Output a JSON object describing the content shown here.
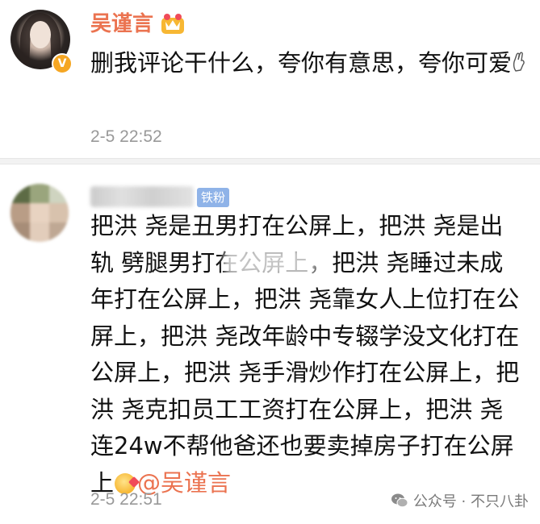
{
  "comment1": {
    "username": "吴谨言",
    "text": "删我评论干什么，夸你有意思，夸你可爱",
    "timestamp": "2-5 22:52",
    "verified_badge": "V",
    "vip_icon": "crown-icon"
  },
  "comment2": {
    "username_blurred": "",
    "fan_badge": "铁粉",
    "text_before": "把洪 尧是丑男打在公屏上，把洪 尧是出轨 劈腿男打在公屏上，把洪 尧睡过未成年打在公屏上，把洪 尧靠女人上位打在公屏上，把洪 尧改年龄中专辍学没文化打在公屏上，把洪 尧手滑炒作打在公屏上，把洪 尧克扣员工工资打在公屏上，把洪 尧连24w不帮他爸还也要卖掉房子打在公屏上",
    "mention": "@吴谨言",
    "timestamp": "2-5 22:51"
  },
  "watermark": {
    "text": "公众号 · 不只八卦",
    "icon": "wechat-icon"
  },
  "colors": {
    "username": "#eb7350",
    "timestamp": "#999999",
    "fan_badge_bg": "#8fb3e8",
    "verified": "#f5a623"
  }
}
